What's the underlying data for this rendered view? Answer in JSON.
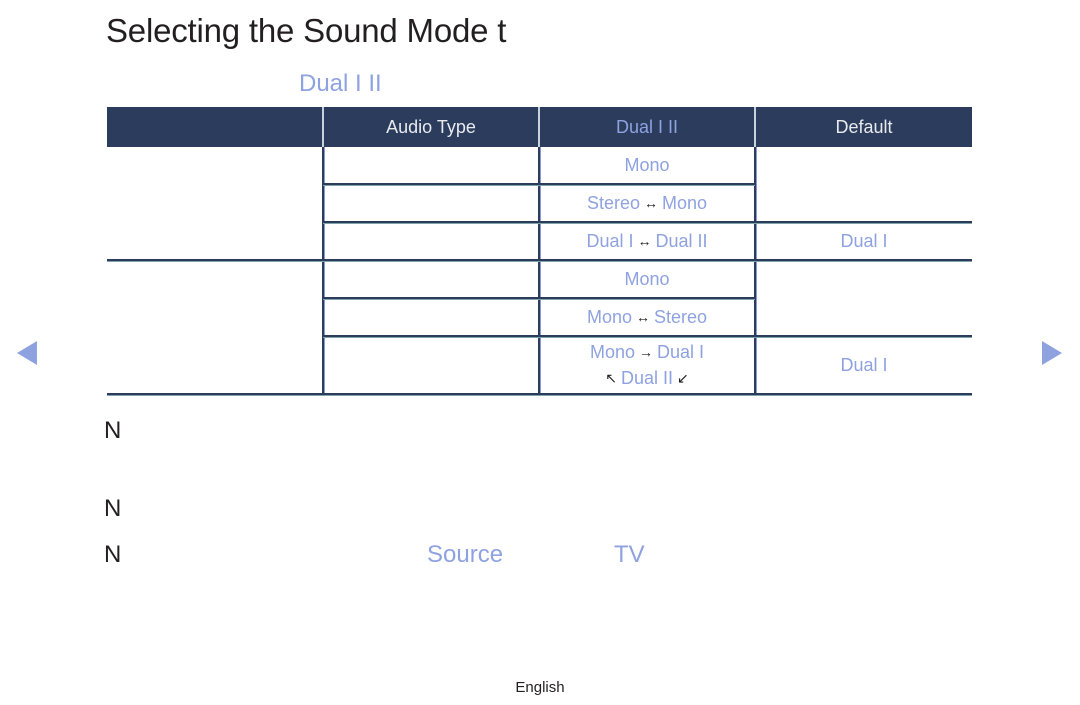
{
  "page": {
    "title": "Selecting the Sound Mode t",
    "subtitle": "Dual I II",
    "footer_language": "English"
  },
  "colors": {
    "accent": "#8fa2e0",
    "header_bg": "#2b3c5d",
    "text": "#231f20"
  },
  "table": {
    "headers": [
      "",
      "Audio Type",
      "Dual I II",
      "Default"
    ],
    "rows": [
      {
        "group": "",
        "audio_type": "",
        "dual": [
          "Mono"
        ],
        "default": ""
      },
      {
        "group": "",
        "audio_type": "",
        "dual": [
          "Stereo",
          "↔",
          "Mono"
        ],
        "default": ""
      },
      {
        "group": "",
        "audio_type": "",
        "dual": [
          "Dual I",
          "↔",
          "Dual II"
        ],
        "default": "Dual I"
      },
      {
        "group": "",
        "audio_type": "",
        "dual": [
          "Mono"
        ],
        "default": ""
      },
      {
        "group": "",
        "audio_type": "",
        "dual": [
          "Mono",
          "↔",
          "Stereo"
        ],
        "default": ""
      },
      {
        "group": "",
        "audio_type": "",
        "dual": [
          "Mono",
          "→",
          "Dual I"
        ],
        "dual_line2": [
          "↖",
          "Dual II",
          "↙"
        ],
        "default": "Dual I"
      }
    ]
  },
  "notes": [
    {
      "marker": "N"
    },
    {
      "marker": "N"
    },
    {
      "marker": "N",
      "links": [
        "Source",
        "TV"
      ]
    }
  ],
  "navigation": {
    "prev_icon": "triangle-left",
    "next_icon": "triangle-right"
  }
}
